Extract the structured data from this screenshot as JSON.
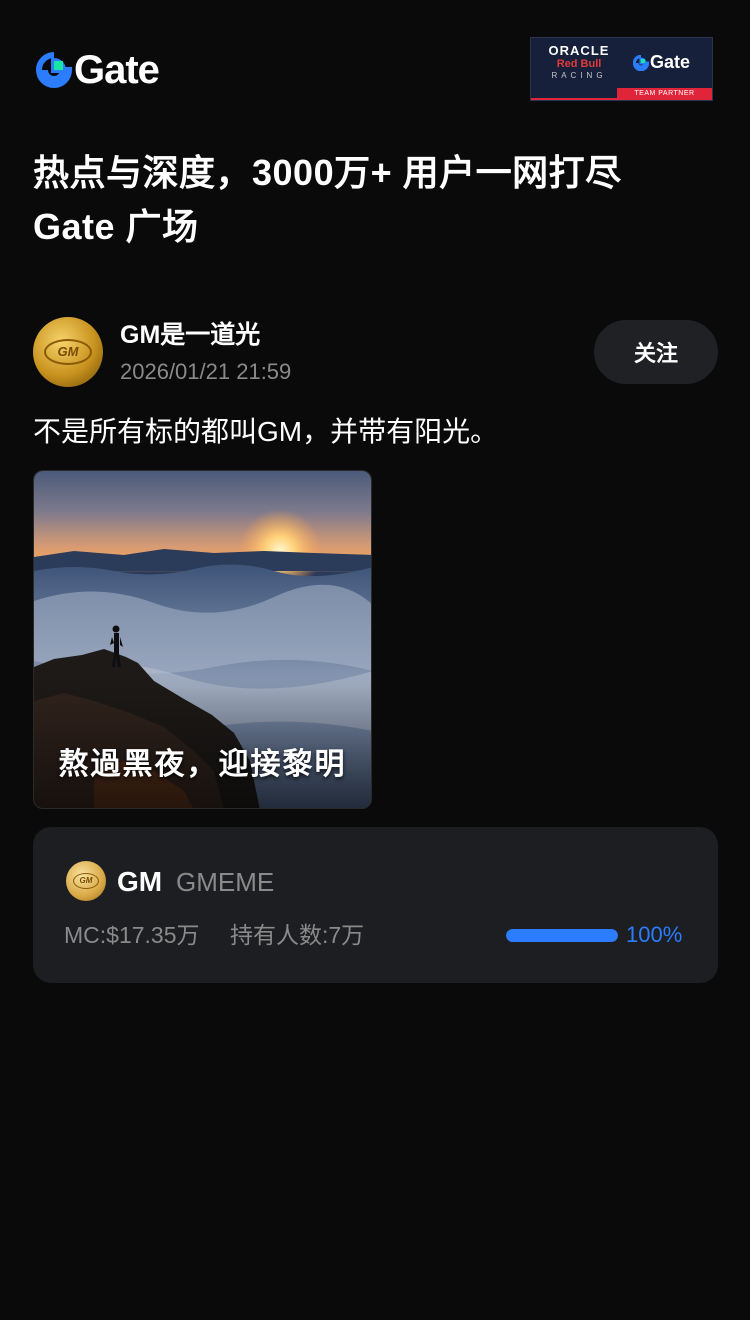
{
  "header": {
    "logo_text": "Gate",
    "partner_badge": {
      "oracle": "ORACLE",
      "redbull": "Red Bull",
      "racing": "RACING",
      "gate": "Gate",
      "strip": "TEAM PARTNER"
    }
  },
  "headline": {
    "line1": "热点与深度，3000万+ 用户一网打尽",
    "line2": "Gate 广场"
  },
  "post": {
    "author": "GM是一道光",
    "avatar_text": "GM",
    "timestamp": "2026/01/21 21:59",
    "follow_label": "关注",
    "text": "不是所有标的都叫GM，并带有阳光。",
    "image_caption": "熬過黑夜，迎接黎明"
  },
  "token": {
    "icon_text": "GM",
    "symbol": "GM",
    "name": "GMEME",
    "market_cap": "MC:$17.35万",
    "holders": "持有人数:7万",
    "progress": 100,
    "progress_label": "100%"
  },
  "colors": {
    "background": "#0a0a0a",
    "card": "#1d1e21",
    "accent_blue": "#2b7cff",
    "muted_text": "#8a8a8a",
    "brand_green": "#17e5a1"
  }
}
